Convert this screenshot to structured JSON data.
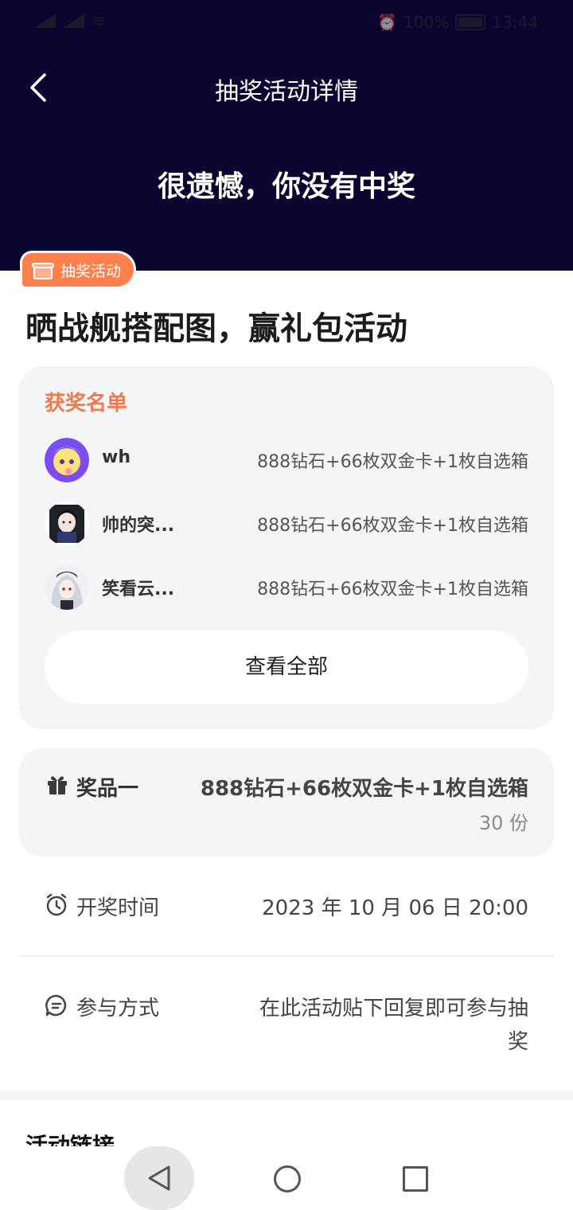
{
  "status_bar": {
    "left_icons": [
      "sim-icon",
      "signal-icon",
      "signal-icon",
      "wifi-icon",
      "nfc-icon"
    ],
    "battery": "100%",
    "time": "13:44"
  },
  "nav": {
    "title": "抽奖活动详情"
  },
  "result": {
    "message": "很遗憾，你没有中奖"
  },
  "tag": {
    "label": "抽奖活动"
  },
  "activity": {
    "title": "晒战舰搭配图，赢礼包活动"
  },
  "winners": {
    "title": "获奖名单",
    "list": [
      {
        "name": "wh",
        "prize": "888钻石+66枚双金卡+1枚自选箱"
      },
      {
        "name": "帅的突...",
        "prize": "888钻石+66枚双金卡+1枚自选箱"
      },
      {
        "name": "笑看云...",
        "prize": "888钻石+66枚双金卡+1枚自选箱"
      }
    ],
    "view_all": "查看全部"
  },
  "prize": {
    "label": "奖品一",
    "name": "888钻石+66枚双金卡+1枚自选箱",
    "count": "30 份"
  },
  "draw_time": {
    "label": "开奖时间",
    "value": "2023 年 10 月 06 日 20:00"
  },
  "participation": {
    "label": "参与方式",
    "value_line1": "在此活动贴下回复即可参与抽",
    "value_line2": "奖"
  },
  "activity_link": {
    "title": "活动链接"
  },
  "colors": {
    "header_bg": "#0b0630",
    "accent": "#ff7f4d",
    "card_bg": "#f4f5f7"
  }
}
